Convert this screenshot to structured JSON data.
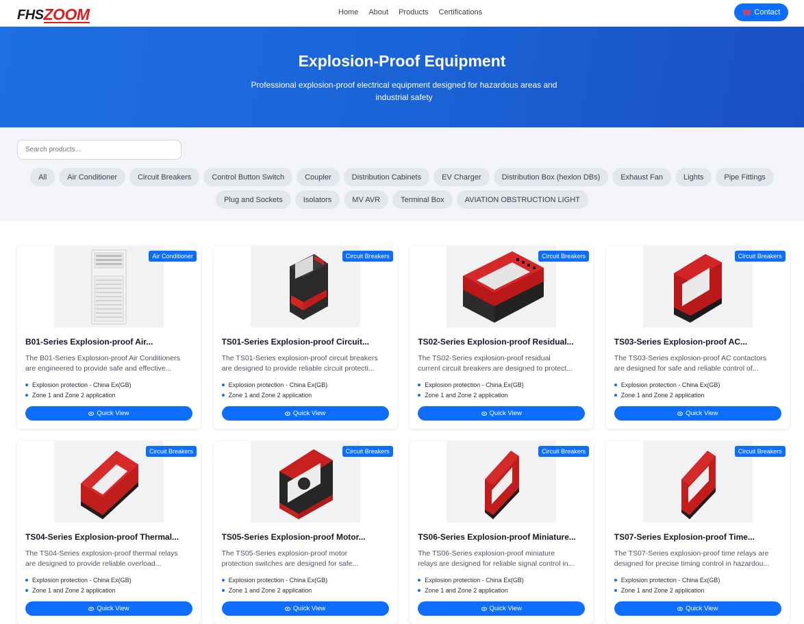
{
  "brand": {
    "logo_part1": "FHS",
    "logo_part2": "ZOOM"
  },
  "nav": {
    "items": [
      "Home",
      "About",
      "Products",
      "Certifications"
    ]
  },
  "contact": {
    "label": "Contact",
    "icon": "phone-icon"
  },
  "hero": {
    "title": "Explosion-Proof Equipment",
    "subtitle": "Professional explosion-proof electrical equipment designed for hazardous areas and industrial safety"
  },
  "search": {
    "placeholder": "Search products..."
  },
  "filters": {
    "row1": [
      "All",
      "Air Conditioner",
      "Circuit Breakers",
      "Control Button Switch",
      "Coupler",
      "Distribution Cabinets",
      "EV Charger",
      "Distribution Box (hexlon DBs)",
      "Exhaust Fan",
      "Lights",
      "Pipe Fittings"
    ],
    "row2": [
      "Plug and Sockets",
      "Isolators",
      "MV AVR",
      "Terminal Box",
      "AVIATION OBSTRUCTION LIGHT"
    ]
  },
  "quick_view_label": "Quick View",
  "products": [
    {
      "badge": "Air Conditioner",
      "title": "B01-Series Explosion-proof Air...",
      "desc1": "The B01-Series Explosion-proof Air Conditioners",
      "desc2": "are engineered to provide safe and effective...",
      "feat1": "Explosion protection - China Ex(GB)",
      "feat2": "Zone 1 and Zone 2 application",
      "kind": "ac"
    },
    {
      "badge": "Circuit Breakers",
      "title": "TS01-Series Explosion-proof Circuit...",
      "desc1": "The TS01-Series explosion-proof circuit breakers",
      "desc2": "are designed to provide reliable circuit protecti...",
      "feat1": "Explosion protection - China Ex(GB)",
      "feat2": "Zone 1 and Zone 2 application",
      "kind": "ts01"
    },
    {
      "badge": "Circuit Breakers",
      "title": "TS02-Series Explosion-proof Residual...",
      "desc1": "The TS02-Series explosion-proof residual",
      "desc2": "current circuit breakers are designed to protect...",
      "feat1": "Explosion protection - China Ex(GB)",
      "feat2": "Zone 1 and Zone 2 application",
      "kind": "ts02"
    },
    {
      "badge": "Circuit Breakers",
      "title": "TS03-Series Explosion-proof AC...",
      "desc1": "The TS03-Series explosion-proof AC contactors",
      "desc2": "are designed for safe and reliable control of...",
      "feat1": "Explosion protection - China Ex(GB)",
      "feat2": "Zone 1 and Zone 2 application",
      "kind": "ts03"
    },
    {
      "badge": "Circuit Breakers",
      "title": "TS04-Series Explosion-proof Thermal...",
      "desc1": "The TS04-Series explosion-proof thermal relays",
      "desc2": "are designed to provide reliable overload...",
      "feat1": "Explosion protection - China Ex(GB)",
      "feat2": "Zone 1 and Zone 2 application",
      "kind": "ts04"
    },
    {
      "badge": "Circuit Breakers",
      "title": "TS05-Series Explosion-proof Motor...",
      "desc1": "The TS05-Series explosion-proof motor",
      "desc2": "protection switches are designed for safe...",
      "feat1": "Explosion protection - China Ex(GB)",
      "feat2": "Zone 1 and Zone 2 application",
      "kind": "ts05"
    },
    {
      "badge": "Circuit Breakers",
      "title": "TS06-Series Explosion-proof Miniature...",
      "desc1": "The TS06-Series explosion-proof miniature",
      "desc2": "relays are designed for reliable signal control in...",
      "feat1": "Explosion protection - China Ex(GB)",
      "feat2": "Zone 1 and Zone 2 application",
      "kind": "ts06"
    },
    {
      "badge": "Circuit Breakers",
      "title": "TS07-Series Explosion-proof Time...",
      "desc1": "The TS07-Series explosion-proof time relays are",
      "desc2": "designed for precise timing control in hazardou...",
      "feat1": "Explosion protection - China Ex(GB)",
      "feat2": "Zone 1 and Zone 2 application",
      "kind": "ts07"
    }
  ]
}
